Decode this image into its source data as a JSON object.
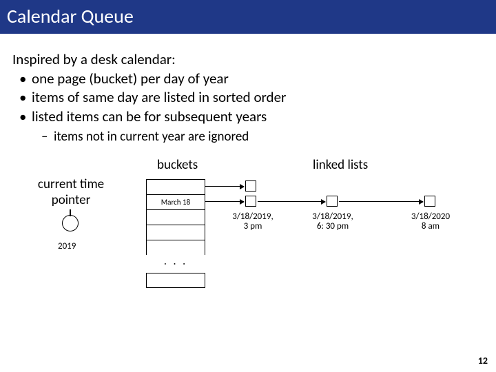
{
  "title": "Calendar Queue",
  "intro": "Inspired by a desk calendar:",
  "bullets": [
    "one page (bucket) per day of year",
    "items of same day are listed in sorted order",
    "listed items can be for subsequent years"
  ],
  "sub": "items not in current year are ignored",
  "diagram": {
    "buckets_label": "buckets",
    "linked_label": "linked lists",
    "ctp_label": "current time pointer",
    "year": "2019",
    "bucket_text": "March 18",
    "ellipsis": ". . .",
    "nodes": [
      {
        "line1": "3/18/2019,",
        "line2": "3 pm"
      },
      {
        "line1": "3/18/2019,",
        "line2": "6: 30 pm"
      },
      {
        "line1": "3/18/2020",
        "line2": "8 am"
      }
    ]
  },
  "page": "12"
}
